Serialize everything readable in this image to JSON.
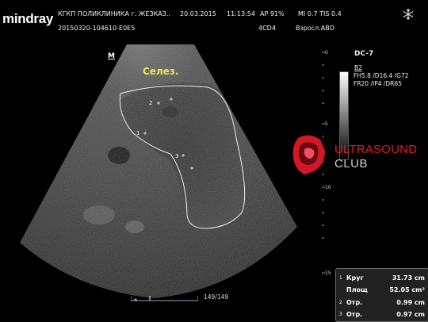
{
  "header": {
    "brand": "mindray",
    "hospital": "КГКП   ПОЛИКЛИНИКА  г. ЖЕЗКАЗ..",
    "date": "20.03.2015",
    "time": "11:13:54",
    "ap": "AP  91%",
    "mi_tis": "MI 0.7  TIS 0.4",
    "exam_id": "20150320-104610-E0E5",
    "probe": "4CD4",
    "preset": "Взросл.ABD"
  },
  "image": {
    "orientation_mark": "M",
    "organ_label": "Селез.",
    "markers": [
      "1",
      "2",
      "3"
    ],
    "depth_ticks": [
      "0",
      "5",
      "10",
      "15"
    ]
  },
  "parameters": {
    "mode": "DC-7",
    "b_mode": "B2",
    "line1": "FH5.8  /D16.4  /G72",
    "line2": "FR20  /IP4     /DR65"
  },
  "watermark": {
    "line1": "ULTRASOUND",
    "line2": "CLUB"
  },
  "cine": {
    "frame": "149/149",
    "fraction": 1.0
  },
  "measurements": [
    {
      "index": "1",
      "name": "Круг",
      "value": "31.73 cm"
    },
    {
      "index": "",
      "name": "Площ",
      "value": "52.05 cm²"
    },
    {
      "index": "2",
      "name": "Отр.",
      "value": "0.99 cm"
    },
    {
      "index": "3",
      "name": "Отр.",
      "value": "0.97 cm"
    }
  ],
  "colors": {
    "organ_label": "#e8e85a",
    "watermark_red": "#e01a2b",
    "watermark_grey": "#d0d0d0"
  }
}
